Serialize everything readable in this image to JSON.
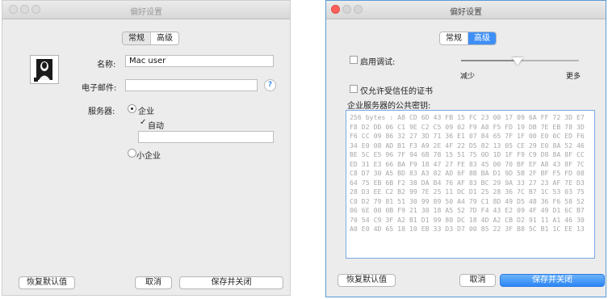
{
  "window1": {
    "title": "偏好设置",
    "tabs": [
      "常规",
      "高级"
    ],
    "name_label": "名称:",
    "name_value": "Mac user",
    "email_label": "电子邮件:",
    "email_value": "",
    "help_glyph": "?",
    "server_label": "服务器:",
    "server_option_enterprise": "企业",
    "auto_checkbox_label": "自动",
    "check_glyph": "✓",
    "server_address_value": "",
    "server_option_small": "小企业",
    "restore_button": "恢复默认值",
    "cancel_button": "取消",
    "save_button": "保存并关闭",
    "avatar_icon": "contact-card-portrait-icon"
  },
  "window2": {
    "title": "偏好设置",
    "tabs": [
      "常规",
      "高级"
    ],
    "debug_label": "启用调试:",
    "slider_min_label": "减少",
    "slider_max_label": "更多",
    "slider_value_fraction": 0.48,
    "trusted_cert_label": "仅允许受信任的证书",
    "public_key_label": "企业服务器的公共密钥:",
    "public_key_value": "256 bytes : A8 CD 6D 43 FB 15 FC 23 00 17 09 6A FF 72 3D E7 F8 D2 DD 06 C1 9E C2 C5 09 02 F9 A8 F5 FD 19 DB 7E EB 78 3D F6 CC 09 86 32 27 3D 71 36 E1 07 84 65 7F 1F 00 E0 0C ED F6 34 E0 08 AD B1 F3 A9 2E 4F 22 D5 82 13 05 CE 29 E0 8A 52 46 BE 5C E5 96 7F 94 6B 78 15 51 75 0D 1D 1F F9 C9 D8 8A 8F CC ED 31 E3 66 BA F9 18 47 27 FE 83 45 00 70 BF EF A8 43 8F 7C C8 D7 30 A5 BD 83 A3 82 AD 6F 8B BA D1 9D 5B 2F BF F5 FD 08 64 75 EB 6B F2 38 DA B4 76 AF 83 BC 29 9A 33 27 23 AF 7E D3 28 D3 EE C2 B2 99 7E 25 11 DC D1 25 28 36 7C B7 1C 53 03 75 C0 D2 79 81 51 30 99 89 50 A4 79 C1 8D 49 D5 48 36 F6 58 52 06 6E 00 0B F9 21 30 18 A5 52 7D F4 43 E2 09 4F 49 D1 6C B7 70 54 C9 3F A2 B1 D1 99 80 DC 18 4D A2 CB D2 91 11 A1 46 30 A0 E0 4D 65 18 10 EB 33 D3 D7 00 85 22 3F B8 5C B1 1C EE 13",
    "restore_button": "恢复默认值",
    "cancel_button": "取消",
    "save_button": "保存并关闭"
  },
  "colors": {
    "accent_blue": "#3f8ff7",
    "close_red": "#fc605b",
    "minimize_gray": "#d6d6d6"
  }
}
